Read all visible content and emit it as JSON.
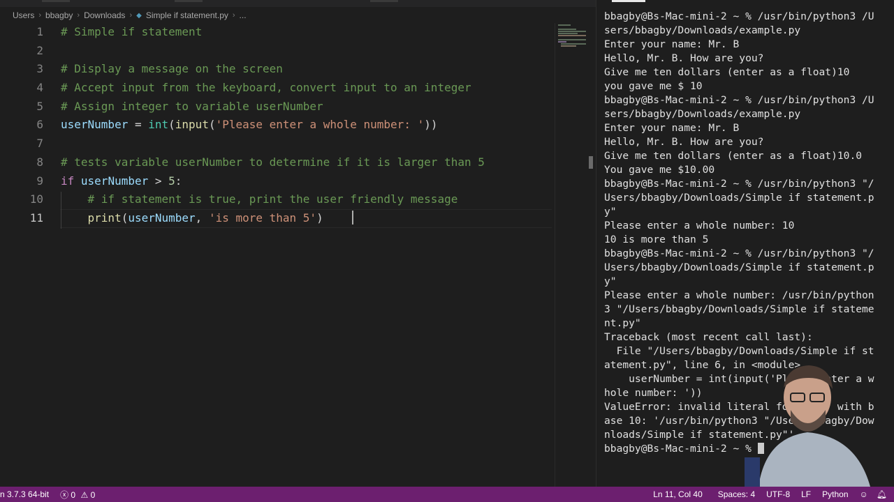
{
  "breadcrumb": [
    "Users",
    "bbagby",
    "Downloads",
    "Simple if statement.py",
    "..."
  ],
  "editor": {
    "lines": [
      {
        "n": "1",
        "tokens": [
          {
            "c": "cm",
            "t": "# Simple if statement"
          }
        ]
      },
      {
        "n": "2",
        "tokens": []
      },
      {
        "n": "3",
        "tokens": [
          {
            "c": "cm",
            "t": "# Display a message on the screen"
          }
        ]
      },
      {
        "n": "4",
        "tokens": [
          {
            "c": "cm",
            "t": "# Accept input from the keyboard, convert input to an integer"
          }
        ]
      },
      {
        "n": "5",
        "tokens": [
          {
            "c": "cm",
            "t": "# Assign integer to variable userNumber"
          }
        ]
      },
      {
        "n": "6",
        "tokens": [
          {
            "c": "var",
            "t": "userNumber"
          },
          {
            "c": "pl",
            "t": " = "
          },
          {
            "c": "bi",
            "t": "int"
          },
          {
            "c": "pl",
            "t": "("
          },
          {
            "c": "fn",
            "t": "input"
          },
          {
            "c": "pl",
            "t": "("
          },
          {
            "c": "str",
            "t": "'Please enter a whole number: '"
          },
          {
            "c": "pl",
            "t": "))"
          }
        ]
      },
      {
        "n": "7",
        "tokens": []
      },
      {
        "n": "8",
        "tokens": [
          {
            "c": "cm",
            "t": "# tests variable userNumber to determine if it is larger than 5"
          }
        ]
      },
      {
        "n": "9",
        "tokens": [
          {
            "c": "kw",
            "t": "if"
          },
          {
            "c": "pl",
            "t": " "
          },
          {
            "c": "var",
            "t": "userNumber"
          },
          {
            "c": "pl",
            "t": " > "
          },
          {
            "c": "num",
            "t": "5"
          },
          {
            "c": "pl",
            "t": ":"
          }
        ]
      },
      {
        "n": "10",
        "tokens": [
          {
            "c": "pl",
            "t": "    "
          },
          {
            "c": "cm",
            "t": "# if statement is true, print the user friendly message"
          }
        ]
      },
      {
        "n": "11",
        "tokens": [
          {
            "c": "pl",
            "t": "    "
          },
          {
            "c": "fn",
            "t": "print"
          },
          {
            "c": "pl",
            "t": "("
          },
          {
            "c": "var",
            "t": "userNumber"
          },
          {
            "c": "pl",
            "t": ", "
          },
          {
            "c": "str",
            "t": "'is more than 5'"
          },
          {
            "c": "pl",
            "t": ")"
          }
        ]
      }
    ]
  },
  "terminal": {
    "lines": [
      "bbagby@Bs-Mac-mini-2 ~ % /usr/bin/python3 /U",
      "sers/bbagby/Downloads/example.py",
      "Enter your name: Mr. B",
      "Hello, Mr. B. How are you?",
      "Give me ten dollars (enter as a float)10",
      "you gave me $ 10",
      "bbagby@Bs-Mac-mini-2 ~ % /usr/bin/python3 /U",
      "sers/bbagby/Downloads/example.py",
      "Enter your name: Mr. B",
      "Hello, Mr. B. How are you?",
      "Give me ten dollars (enter as a float)10.0",
      "You gave me $10.00",
      "bbagby@Bs-Mac-mini-2 ~ % /usr/bin/python3 \"/",
      "Users/bbagby/Downloads/Simple if statement.p",
      "y\"",
      "Please enter a whole number: 10",
      "10 is more than 5",
      "bbagby@Bs-Mac-mini-2 ~ % /usr/bin/python3 \"/",
      "Users/bbagby/Downloads/Simple if statement.p",
      "y\"",
      "Please enter a whole number: /usr/bin/python",
      "3 \"/Users/bbagby/Downloads/Simple if stateme",
      "nt.py\"",
      "Traceback (most recent call last):",
      "  File \"/Users/bbagby/Downloads/Simple if st",
      "atement.py\", line 6, in <module>",
      "    userNumber = int(input('Please enter a w",
      "hole number: '))",
      "ValueError: invalid literal for int() with b",
      "ase 10: '/usr/bin/python3 \"/Users/bbagby/Dow",
      "nloads/Simple if statement.py\"'",
      "bbagby@Bs-Mac-mini-2 ~ % "
    ]
  },
  "statusbar": {
    "interpreter": "n 3.7.3 64-bit",
    "errors": "0",
    "warnings": "0",
    "position": "Ln 11, Col 40",
    "spaces": "Spaces: 4",
    "encoding": "UTF-8",
    "eol": "LF",
    "language": "Python"
  },
  "colors": {
    "statusbar": "#6c1f6f",
    "editor_bg": "#1e1e1e",
    "comment": "#6a9955",
    "string": "#ce9178"
  }
}
